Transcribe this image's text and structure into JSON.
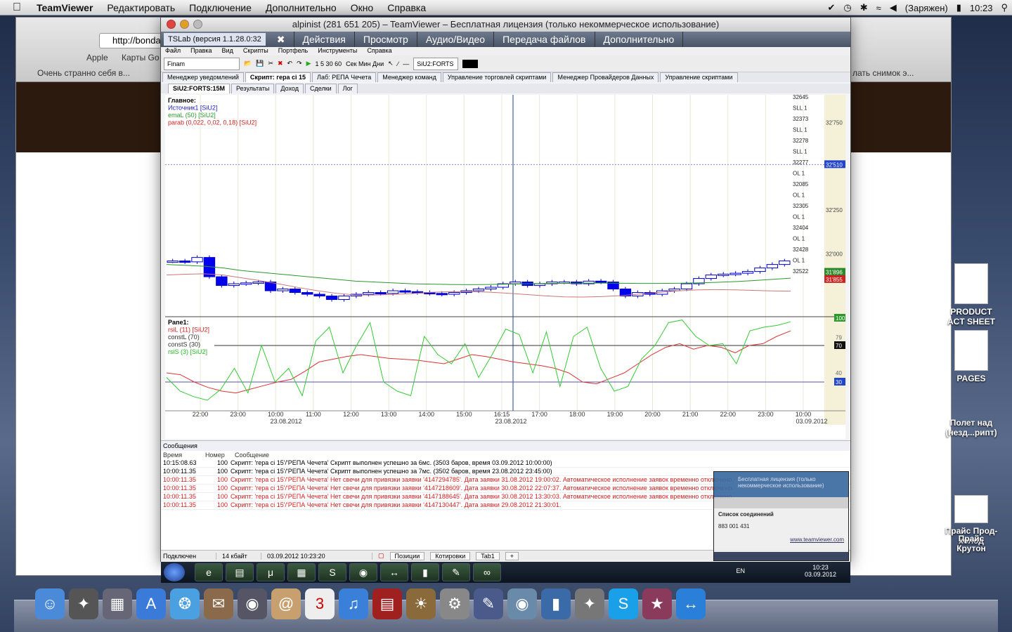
{
  "menubar": {
    "app": "TeamViewer",
    "items": [
      "Редактировать",
      "Подключение",
      "Дополнительно",
      "Окно",
      "Справка"
    ],
    "battery": "(Заряжен)",
    "time": "10:23"
  },
  "safari": {
    "url": "http://bondare",
    "bookmarks": [
      "Apple",
      "Карты Go"
    ],
    "tab": "Очень странно себя в...",
    "tab_right": "лать снимок э..."
  },
  "desktop_icons": [
    "PRODUCT ACT SHEET",
    "PAGES",
    "Полет над (незд...рипт)",
    "Прайс Прод- холод",
    "Прайс Крутон"
  ],
  "teamviewer": {
    "title": "alpinist (281 651 205) – TeamViewer – Бесплатная лицензия (только некоммерческое использование)",
    "app_tab": "TSLab (версия 1.1.28.0:32",
    "toolbar": [
      "Действия",
      "Просмотр",
      "Аудио/Видео",
      "Передача файлов",
      "Дополнительно"
    ]
  },
  "tslab": {
    "menu": [
      "Файл",
      "Правка",
      "Вид",
      "Скрипты",
      "Портфель",
      "Инструменты",
      "Справка"
    ],
    "combo_provider": "Finam",
    "timeframes": "1  5  30  60",
    "tf_units": "Сек  Мин  Дни",
    "combo_symbol": "SiU2:FORTS",
    "tabs1": [
      "Менеджер уведомлений",
      "Скрипт: гера ci 15",
      "Лаб: РЕПА Чечета",
      "Менеджер команд",
      "Управление торговлей скриптами",
      "Менеджер Провайдеров Данных",
      "Управление скриптами"
    ],
    "tabs2": [
      "SiU2:FORTS:15M",
      "Результаты",
      "Доход",
      "Сделки",
      "Лог"
    ]
  },
  "chart_data": {
    "type": "candlestick",
    "main_legend": [
      "Главное:",
      "Источник1 [SiU2]",
      "emaL (50) [SiU2]",
      "parab (0,022, 0,02, 0,18) [SiU2]"
    ],
    "pane_legend": [
      "Pane1:",
      "rsiL (11) [SiU2]",
      "constL (70)",
      "constS (30)",
      "rsiS (3) [SiU2]"
    ],
    "price_ticks": [
      "32'750",
      "32'510",
      "32'250",
      "32'000",
      "31'896",
      "31'855"
    ],
    "rsi_ticks": [
      "100",
      "79",
      "70",
      "40",
      "30"
    ],
    "x_ticks": [
      "22:00",
      "23:00",
      "10:00",
      "11:00",
      "12:00",
      "13:00",
      "14:00",
      "15:00",
      "16:15",
      "17:00",
      "18:00",
      "19:00",
      "20:00",
      "21:00",
      "22:00",
      "23:00",
      "10:00"
    ],
    "x_dates": [
      "23.08.2012",
      "23.08.2012",
      "03.09.2012"
    ],
    "trade_labels": [
      "32645",
      "SLL 1",
      "32373",
      "SLL 1",
      "32278",
      "SLL 1",
      "32277",
      "OL 1",
      "32085",
      "OL 1",
      "32305",
      "OL 1",
      "32404",
      "OL 1",
      "32428",
      "OL 1",
      "32522"
    ],
    "candles": [
      31960,
      31955,
      31980,
      31870,
      31820,
      31830,
      31835,
      31840,
      31790,
      31800,
      31780,
      31770,
      31760,
      31740,
      31760,
      31770,
      31780,
      31775,
      31790,
      31785,
      31780,
      31775,
      31770,
      31780,
      31790,
      31800,
      31810,
      31830,
      31840,
      31820,
      31830,
      31840,
      31840,
      31830,
      31845,
      31840,
      31800,
      31760,
      31780,
      31770,
      31790,
      31800,
      31830,
      31860,
      31880,
      31885,
      31890,
      31900,
      31920,
      31940,
      31960
    ],
    "ema": [
      31940,
      31935,
      31930,
      31920,
      31905,
      31895,
      31885,
      31875,
      31865,
      31855,
      31845,
      31840,
      31835,
      31830,
      31828,
      31826,
      31825,
      31826,
      31828,
      31830,
      31832,
      31833,
      31834,
      31834,
      31833,
      31832,
      31832,
      31833,
      31835,
      31838,
      31842,
      31848,
      31855,
      31862
    ],
    "rsiL": [
      40,
      38,
      30,
      24,
      20,
      18,
      22,
      26,
      30,
      33,
      42,
      52,
      55,
      58,
      60,
      58,
      56,
      55,
      54,
      52,
      50,
      55,
      60,
      58,
      55,
      52,
      50,
      48,
      45,
      40,
      30,
      28,
      34,
      40,
      50,
      60,
      68,
      72,
      66,
      70,
      68,
      62,
      70,
      72,
      80,
      86
    ],
    "rsiS": [
      35,
      20,
      14,
      10,
      22,
      45,
      18,
      70,
      30,
      45,
      15,
      75,
      90,
      40,
      70,
      95,
      30,
      20,
      15,
      80,
      60,
      50,
      72,
      35,
      60,
      88,
      82,
      40,
      85,
      25,
      80,
      90,
      45,
      20,
      25,
      55,
      70,
      95,
      98,
      80,
      70,
      72,
      50,
      86,
      90,
      92,
      96
    ]
  },
  "messages": {
    "title": "Сообщения",
    "cols": [
      "Время",
      "Номер",
      "Сообщение"
    ],
    "rows": [
      {
        "t": "10:15:08.63",
        "n": "100",
        "m": "Скрипт: 'гера ci 15'/'РЕПА Чечета' Скрипт выполнен успешно за 6мс. (3503 баров, время 03.09.2012 10:00:00)",
        "red": false
      },
      {
        "t": "10:00:11.35",
        "n": "100",
        "m": "Скрипт: 'гера ci 15'/'РЕПА Чечета' Скрипт выполнен успешно за 7мс. (3502 баров, время 23.08.2012 23:45:00)",
        "red": false
      },
      {
        "t": "10:00:11.35",
        "n": "100",
        "m": "Скрипт: 'гера ci 15'/'РЕПА Чечета' Нет свечи для привязки заявки '4147294785'. Дата заявки 31.08.2012 19:00:02. Автоматическое исполнение заявок временно отключено.",
        "red": true
      },
      {
        "t": "10:00:11.35",
        "n": "100",
        "m": "Скрипт: 'гера ci 15'/'РЕПА Чечета' Нет свечи для привязки заявки '4147218609'. Дата заявки 30.08.2012 22:07:37. Автоматическое исполнение заявок временно отключено.",
        "red": true
      },
      {
        "t": "10:00:11.35",
        "n": "100",
        "m": "Скрипт: 'гера ci 15'/'РЕПА Чечета' Нет свечи для привязки заявки '4147188645'. Дата заявки 30.08.2012 13:30:03. Автоматическое исполнение заявок временно отключено.",
        "red": true
      },
      {
        "t": "10:00:11.35",
        "n": "100",
        "m": "Скрипт: 'гера ci 15'/'РЕПА Чечета' Нет свечи для привязки заявки '4147130447'. Дата заявки 29.08.2012 21:30:01.",
        "red": true
      }
    ]
  },
  "status": {
    "conn": "Подключен",
    "size": "14 кбайт",
    "time": "03.09.2012 10:23:20",
    "tabs": [
      "Позиции",
      "Котировки",
      "Tab1",
      "+"
    ]
  },
  "tvpanel": {
    "license": "Бесплатная лицензия (только некоммерческое использование)",
    "list_title": "Список соединений",
    "entry": "883 001 431",
    "link": "www.teamviewer.com"
  },
  "wintask": {
    "lang": "EN",
    "time": "10:23",
    "date": "03.09.2012"
  }
}
